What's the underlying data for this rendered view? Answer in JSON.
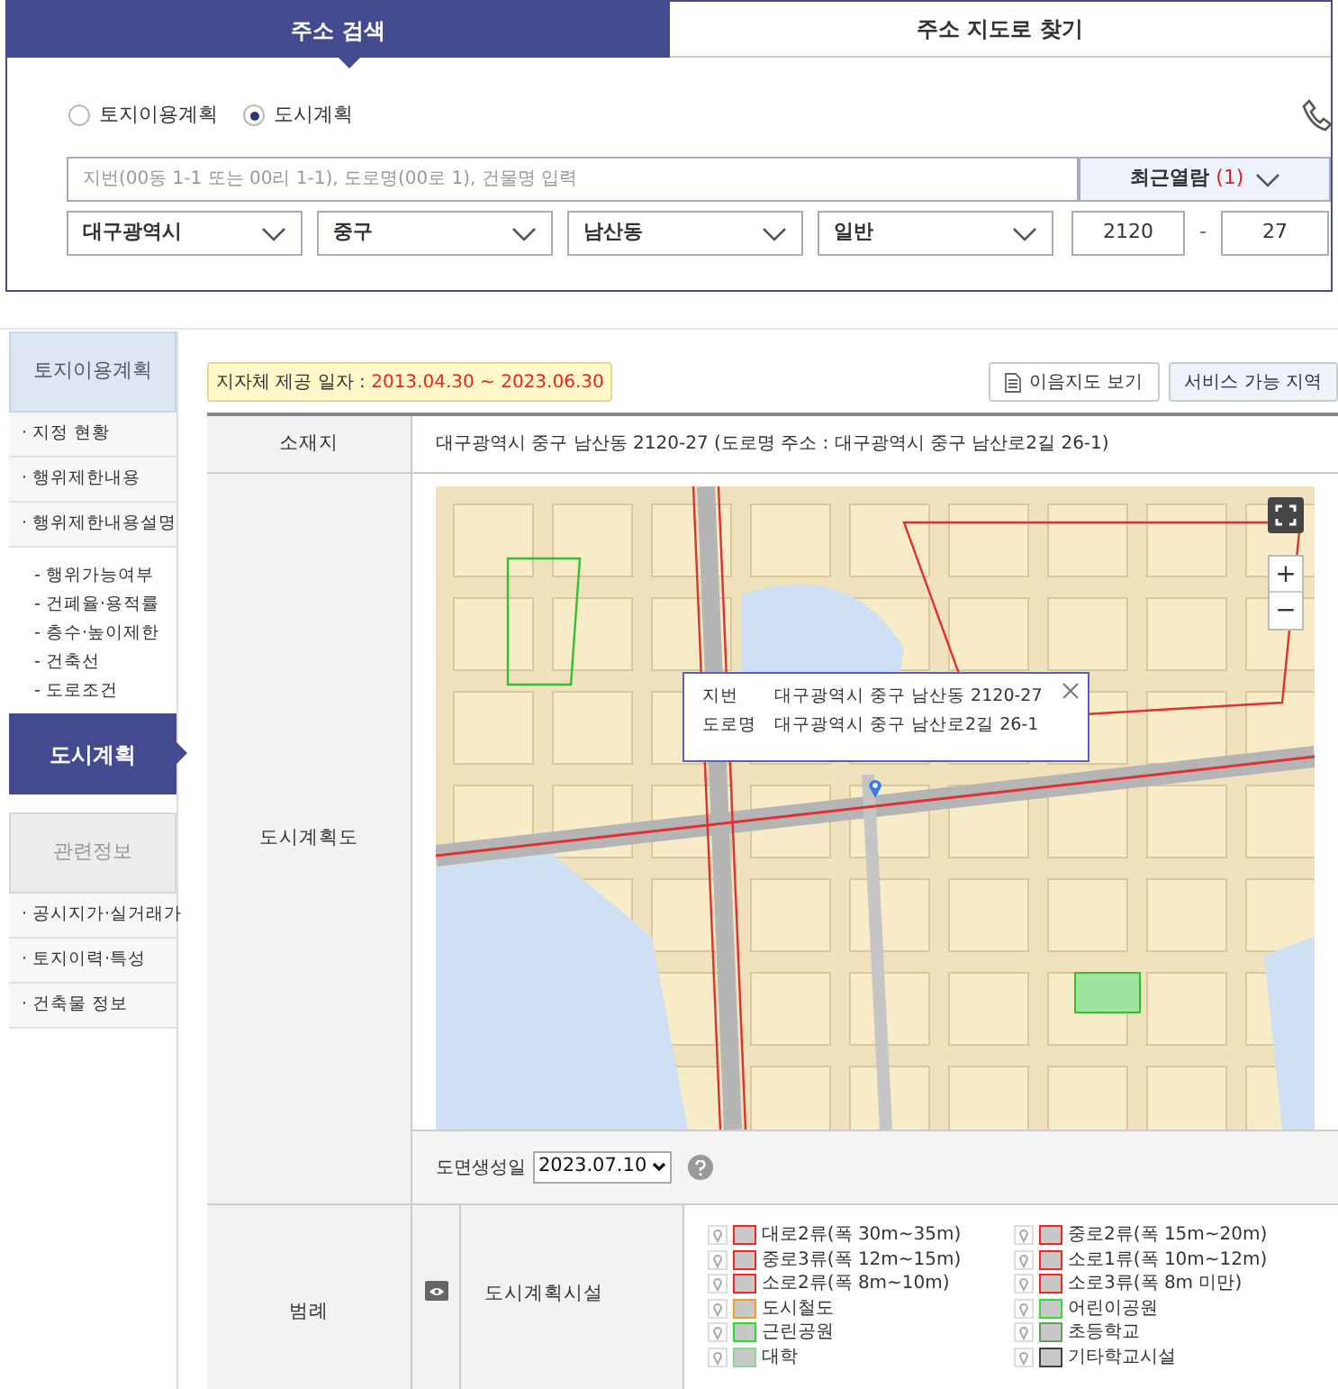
{
  "tabs": [
    {
      "label": "주소 검색",
      "selected": true
    },
    {
      "label": "주소 지도로 찾기",
      "selected": false
    }
  ],
  "radios": [
    {
      "label": "토지이용계획",
      "selected": false
    },
    {
      "label": "도시계획",
      "selected": true
    }
  ],
  "search": {
    "placeholder": "지번(00동 1-1 또는 00리 1-1), 도로명(00로 1), 건물명 입력",
    "recent_label": "최근열람",
    "recent_count": "(1)"
  },
  "selects": [
    "대구광역시",
    "중구",
    "남산동",
    "일반"
  ],
  "lot": {
    "main": "2120",
    "separator": "-",
    "sub": "27"
  },
  "sidebar": [
    {
      "kind": "header",
      "label": "토지이용계획",
      "active": true
    },
    {
      "kind": "item",
      "label": "· 지정 현황",
      "selected": false
    },
    {
      "kind": "item",
      "label": "· 행위제한내용",
      "selected": false
    },
    {
      "kind": "item",
      "label": "· 행위제한내용설명",
      "selected": false
    },
    {
      "kind": "sub",
      "label": "- 행위가능여부"
    },
    {
      "kind": "sub",
      "label": "- 건폐율·용적률"
    },
    {
      "kind": "sub",
      "label": "- 층수·높이제한"
    },
    {
      "kind": "sub",
      "label": "- 건축선"
    },
    {
      "kind": "sub",
      "label": "- 도로조건"
    },
    {
      "kind": "item",
      "label": "도시계획",
      "selected": true
    },
    {
      "kind": "header",
      "label": "관련정보",
      "active": false
    },
    {
      "kind": "item",
      "label": "· 공시지가·실거래가",
      "selected": false
    },
    {
      "kind": "item",
      "label": "· 토지이력·특성",
      "selected": false
    },
    {
      "kind": "item",
      "label": "· 건축물 정보",
      "selected": false
    }
  ],
  "provide_date": {
    "label": "지자체 제공 일자 :",
    "value": "2013.04.30 ~ 2023.06.30"
  },
  "buttons": [
    "이음지도 보기",
    "서비스 가능 지역"
  ],
  "location": {
    "label": "소재지",
    "value": "대구광역시 중구 남산동 2120-27 (도로명 주소 : 대구광역시 중구 남산로2길 26-1)"
  },
  "map_row": {
    "label": "도시계획도",
    "popup": [
      {
        "key": "지번",
        "value": "대구광역시 중구 남산동 2120-27"
      },
      {
        "key": "도로명",
        "value": "대구광역시 중구 남산로2길 26-1"
      }
    ],
    "zoom_in": "+",
    "zoom_out": "−"
  },
  "map_date": {
    "label": "도면생성일",
    "value": "2023.07.10"
  },
  "legend": {
    "label": "범례",
    "group": "도시계획시설",
    "items": [
      {
        "label": "대로2류(폭 30m~35m)",
        "color": "#ff2020"
      },
      {
        "label": "중로2류(폭 15m~20m)",
        "color": "#ff2020"
      },
      {
        "label": "중로3류(폭 12m~15m)",
        "color": "#ff2020"
      },
      {
        "label": "소로1류(폭 10m~12m)",
        "color": "#ff2020"
      },
      {
        "label": "소로2류(폭 8m~10m)",
        "color": "#ff2020"
      },
      {
        "label": "소로3류(폭 8m 미만)",
        "color": "#ff2020"
      },
      {
        "label": "도시철도",
        "color": "#f0a020"
      },
      {
        "label": "어린이공원",
        "color": "#30e030"
      },
      {
        "label": "근린공원",
        "color": "#20e020"
      },
      {
        "label": "초등학교",
        "color": "#60a060"
      },
      {
        "label": "대학",
        "color": "#90d890"
      },
      {
        "label": "기타학교시설",
        "color": "#404040"
      }
    ]
  }
}
